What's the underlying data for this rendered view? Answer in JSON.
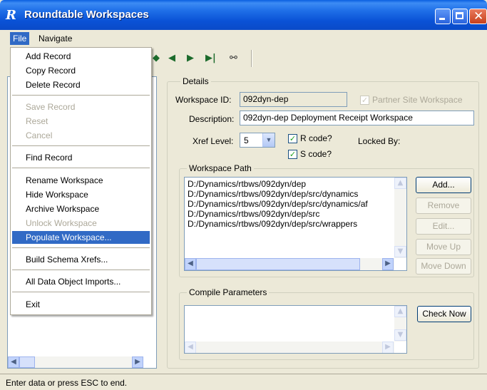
{
  "window": {
    "title": "Roundtable Workspaces",
    "app_glyph": "R"
  },
  "menubar": {
    "file": "File",
    "navigate": "Navigate"
  },
  "file_menu": {
    "items": [
      {
        "label": "Add Record",
        "enabled": true
      },
      {
        "label": "Copy Record",
        "enabled": true
      },
      {
        "label": "Delete Record",
        "enabled": true
      },
      {
        "label": "Save Record",
        "enabled": false
      },
      {
        "label": "Reset",
        "enabled": false
      },
      {
        "label": "Cancel",
        "enabled": false
      },
      {
        "label": "Find Record",
        "enabled": true
      },
      {
        "label": "Rename Workspace",
        "enabled": true
      },
      {
        "label": "Hide Workspace",
        "enabled": true
      },
      {
        "label": "Archive Workspace",
        "enabled": true
      },
      {
        "label": "Unlock Workspace",
        "enabled": false
      },
      {
        "label": "Populate Workspace...",
        "enabled": true,
        "highlighted": true
      },
      {
        "label": "Build Schema Xrefs...",
        "enabled": true
      },
      {
        "label": "All Data Object Imports...",
        "enabled": true
      },
      {
        "label": "Exit",
        "enabled": true
      }
    ]
  },
  "details": {
    "legend": "Details",
    "workspace_id_label": "Workspace ID:",
    "workspace_id": "092dyn-dep",
    "partner_site_label": "Partner Site Workspace",
    "partner_site_checked": true,
    "description_label": "Description:",
    "description": "092dyn-dep Deployment Receipt Workspace",
    "xref_level_label": "Xref Level:",
    "xref_level": "5",
    "rcode_label": "R code?",
    "rcode_checked": true,
    "scode_label": "S code?",
    "scode_checked": true,
    "locked_by_label": "Locked By:"
  },
  "workspace_path": {
    "legend": "Workspace Path",
    "paths": [
      "D:/Dynamics/rtbws/092dyn/dep",
      "D:/Dynamics/rtbws/092dyn/dep/src/dynamics",
      "D:/Dynamics/rtbws/092dyn/dep/src/dynamics/af",
      "D:/Dynamics/rtbws/092dyn/dep/src",
      "D:/Dynamics/rtbws/092dyn/dep/src/wrappers"
    ],
    "buttons": {
      "add": "Add...",
      "remove": "Remove",
      "edit": "Edit...",
      "move_up": "Move Up",
      "move_down": "Move Down"
    }
  },
  "compile_parameters": {
    "legend": "Compile Parameters",
    "check_now": "Check Now"
  },
  "statusbar": {
    "text": "Enter data or press ESC to end."
  },
  "glyphs": {
    "check": "✓",
    "combo_arrow": "▼",
    "left": "◀",
    "right": "▶",
    "up": "▲",
    "down": "▼",
    "close": "✕",
    "binoculars": "⚯"
  }
}
